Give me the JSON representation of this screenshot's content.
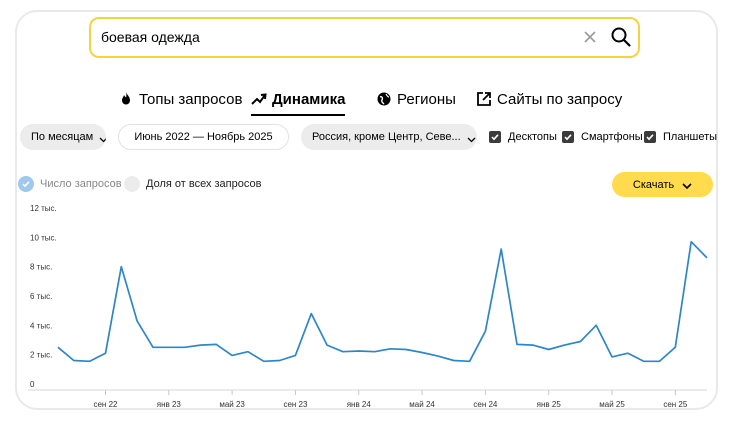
{
  "search": {
    "value": "боевая одежда"
  },
  "tabs": [
    {
      "label": "Топы запросов",
      "icon": "fire-icon"
    },
    {
      "label": "Динамика",
      "icon": "trend-icon",
      "active": true
    },
    {
      "label": "Регионы",
      "icon": "globe-icon"
    },
    {
      "label": "Сайты по запросу",
      "icon": "external-link-icon"
    }
  ],
  "filters": {
    "period_group": "По месяцам",
    "date_range": "Июнь 2022 — Ноябрь 2025",
    "region": "Россия, кроме Центр, Севе..."
  },
  "devices": [
    {
      "label": "Десктопы",
      "checked": true
    },
    {
      "label": "Смартфоны",
      "checked": true
    },
    {
      "label": "Планшеты",
      "checked": true
    }
  ],
  "metrics": [
    {
      "label": "Число запросов",
      "selected": true
    },
    {
      "label": "Доля от всех запросов",
      "selected": false
    }
  ],
  "download_label": "Скачать",
  "colors": {
    "accent_yellow": "#ffdb4d",
    "search_border": "#f5d33c",
    "line": "#2f86c6",
    "radio_selected": "#9ec8ee"
  },
  "chart_data": {
    "type": "line",
    "x": [
      "2022-06",
      "2022-07",
      "2022-08",
      "2022-09",
      "2022-10",
      "2022-11",
      "2022-12",
      "2023-01",
      "2023-02",
      "2023-03",
      "2023-04",
      "2023-05",
      "2023-06",
      "2023-07",
      "2023-08",
      "2023-09",
      "2023-10",
      "2023-11",
      "2023-12",
      "2024-01",
      "2024-02",
      "2024-03",
      "2024-04",
      "2024-05",
      "2024-06",
      "2024-07",
      "2024-08",
      "2024-09",
      "2024-10",
      "2024-11",
      "2024-12",
      "2025-01",
      "2025-02",
      "2025-03",
      "2025-04",
      "2025-05",
      "2025-06",
      "2025-07",
      "2025-08",
      "2025-09",
      "2025-10",
      "2025-11"
    ],
    "series": [
      {
        "values": [
          2500,
          1600,
          1550,
          2100,
          8000,
          4300,
          2500,
          2500,
          2500,
          2650,
          2700,
          1950,
          2200,
          1550,
          1600,
          1950,
          4800,
          2650,
          2200,
          2250,
          2200,
          2400,
          2350,
          2150,
          1900,
          1600,
          1550,
          3600,
          9200,
          2700,
          2650,
          2350,
          2650,
          2900,
          4000,
          1850,
          2100,
          1550,
          1550,
          2500,
          9700,
          8600
        ]
      }
    ],
    "y_ticks": [
      "0",
      "2 тыс.",
      "4 тыс.",
      "6 тыс.",
      "8 тыс.",
      "10 тыс.",
      "12 тыс."
    ],
    "y_tick_values": [
      0,
      2000,
      4000,
      6000,
      8000,
      10000,
      12000
    ],
    "x_ticks": [
      {
        "x": "2022-09",
        "label": "сен 22"
      },
      {
        "x": "2023-01",
        "label": "янв 23"
      },
      {
        "x": "2023-05",
        "label": "май 23"
      },
      {
        "x": "2023-09",
        "label": "сен 23"
      },
      {
        "x": "2024-01",
        "label": "янв 24"
      },
      {
        "x": "2024-05",
        "label": "май 24"
      },
      {
        "x": "2024-09",
        "label": "сен 24"
      },
      {
        "x": "2025-01",
        "label": "янв 25"
      },
      {
        "x": "2025-05",
        "label": "май 25"
      },
      {
        "x": "2025-09",
        "label": "сен 25"
      }
    ],
    "ylim": [
      0,
      12000
    ]
  }
}
